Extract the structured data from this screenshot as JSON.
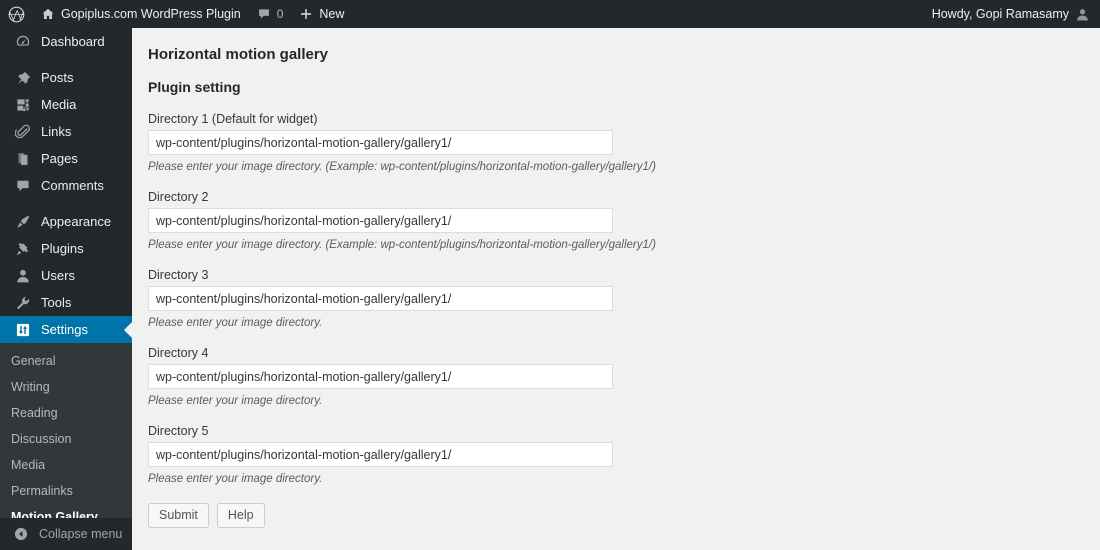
{
  "adminbar": {
    "logo_icon": "wordpress-logo-icon",
    "site_icon": "home-icon",
    "site_name": "Gopiplus.com WordPress Plugin",
    "comments_icon": "comment-bubble-icon",
    "comments_count": "0",
    "new_icon": "plus-icon",
    "new_label": "New",
    "howdy": "Howdy, Gopi Ramasamy",
    "avatar_icon": "user-avatar-icon"
  },
  "sidebar": {
    "items": [
      {
        "label": "Dashboard",
        "icon": "dashboard-icon",
        "active": false
      },
      {
        "label": "Posts",
        "icon": "pin-icon",
        "active": false
      },
      {
        "label": "Media",
        "icon": "media-icon",
        "active": false
      },
      {
        "label": "Links",
        "icon": "paperclip-icon",
        "active": false
      },
      {
        "label": "Pages",
        "icon": "pages-icon",
        "active": false
      },
      {
        "label": "Comments",
        "icon": "comment-icon",
        "active": false
      },
      {
        "label": "Appearance",
        "icon": "brush-icon",
        "active": false
      },
      {
        "label": "Plugins",
        "icon": "plugin-icon",
        "active": false
      },
      {
        "label": "Users",
        "icon": "user-icon",
        "active": false
      },
      {
        "label": "Tools",
        "icon": "wrench-icon",
        "active": false
      },
      {
        "label": "Settings",
        "icon": "settings-sliders-icon",
        "active": true
      }
    ],
    "submenu": [
      {
        "label": "General",
        "current": false
      },
      {
        "label": "Writing",
        "current": false
      },
      {
        "label": "Reading",
        "current": false
      },
      {
        "label": "Discussion",
        "current": false
      },
      {
        "label": "Media",
        "current": false
      },
      {
        "label": "Permalinks",
        "current": false
      },
      {
        "label": "Motion Gallery",
        "current": true
      }
    ],
    "collapse": {
      "label": "Collapse menu",
      "icon": "collapse-arrow-icon"
    }
  },
  "main": {
    "page_title": "Horizontal motion gallery",
    "section_title": "Plugin setting",
    "fields": [
      {
        "label": "Directory 1 (Default for widget)",
        "value": "wp-content/plugins/horizontal-motion-gallery/gallery1/",
        "desc": "Please enter your image directory. (Example: wp-content/plugins/horizontal-motion-gallery/gallery1/)"
      },
      {
        "label": "Directory 2",
        "value": "wp-content/plugins/horizontal-motion-gallery/gallery1/",
        "desc": "Please enter your image directory. (Example: wp-content/plugins/horizontal-motion-gallery/gallery1/)"
      },
      {
        "label": "Directory 3",
        "value": "wp-content/plugins/horizontal-motion-gallery/gallery1/",
        "desc": "Please enter your image directory."
      },
      {
        "label": "Directory 4",
        "value": "wp-content/plugins/horizontal-motion-gallery/gallery1/",
        "desc": "Please enter your image directory."
      },
      {
        "label": "Directory 5",
        "value": "wp-content/plugins/horizontal-motion-gallery/gallery1/",
        "desc": "Please enter your image directory."
      }
    ],
    "submit_label": "Submit",
    "help_label": "Help"
  },
  "colors": {
    "adminbar_bg": "#23282d",
    "sidebar_bg": "#23282d",
    "submenu_bg": "#32373c",
    "accent_blue": "#0073aa",
    "page_bg": "#f1f1f1"
  }
}
